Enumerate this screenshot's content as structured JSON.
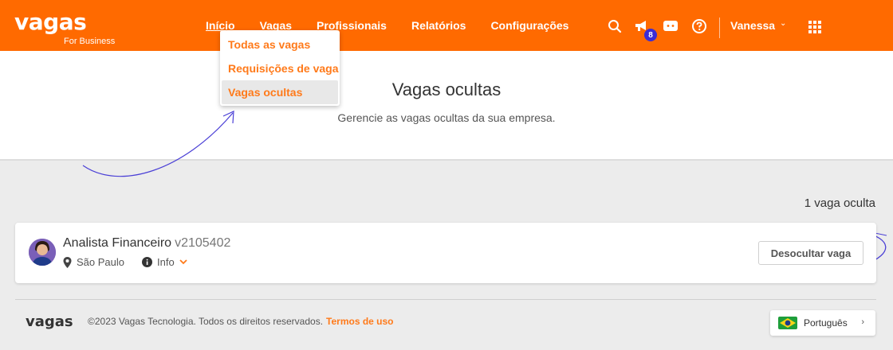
{
  "brand": {
    "name": "vagas",
    "tagline": "For Business",
    "primary_color": "#ff6a00",
    "accent_color": "#ff7a1a"
  },
  "nav": {
    "items": [
      {
        "label": "Início"
      },
      {
        "label": "Vagas"
      },
      {
        "label": "Profissionais"
      },
      {
        "label": "Relatórios"
      },
      {
        "label": "Configurações"
      }
    ],
    "notifications_count": "8",
    "user_name": "Vanessa",
    "icons": [
      "search-icon",
      "megaphone-icon",
      "chat-icon",
      "help-icon",
      "apps-grid-icon"
    ]
  },
  "dropdown": {
    "items": [
      {
        "label": "Todas as vagas"
      },
      {
        "label": "Requisições de vaga"
      },
      {
        "label": "Vagas ocultas"
      }
    ],
    "selected": "Vagas ocultas"
  },
  "page": {
    "title": "Vagas ocultas",
    "subtitle": "Gerencie as vagas ocultas da sua empresa.",
    "count_label": "1 vaga oculta"
  },
  "job": {
    "title": "Analista Financeiro",
    "code": "v2105402",
    "location": "São Paulo",
    "info_label": "Info",
    "unhide_label": "Desocultar vaga"
  },
  "footer": {
    "logo": "vagas",
    "copyright": "©2023 Vagas Tecnologia. Todos os direitos reservados.",
    "terms_label": "Termos de uso",
    "language": "Português"
  }
}
